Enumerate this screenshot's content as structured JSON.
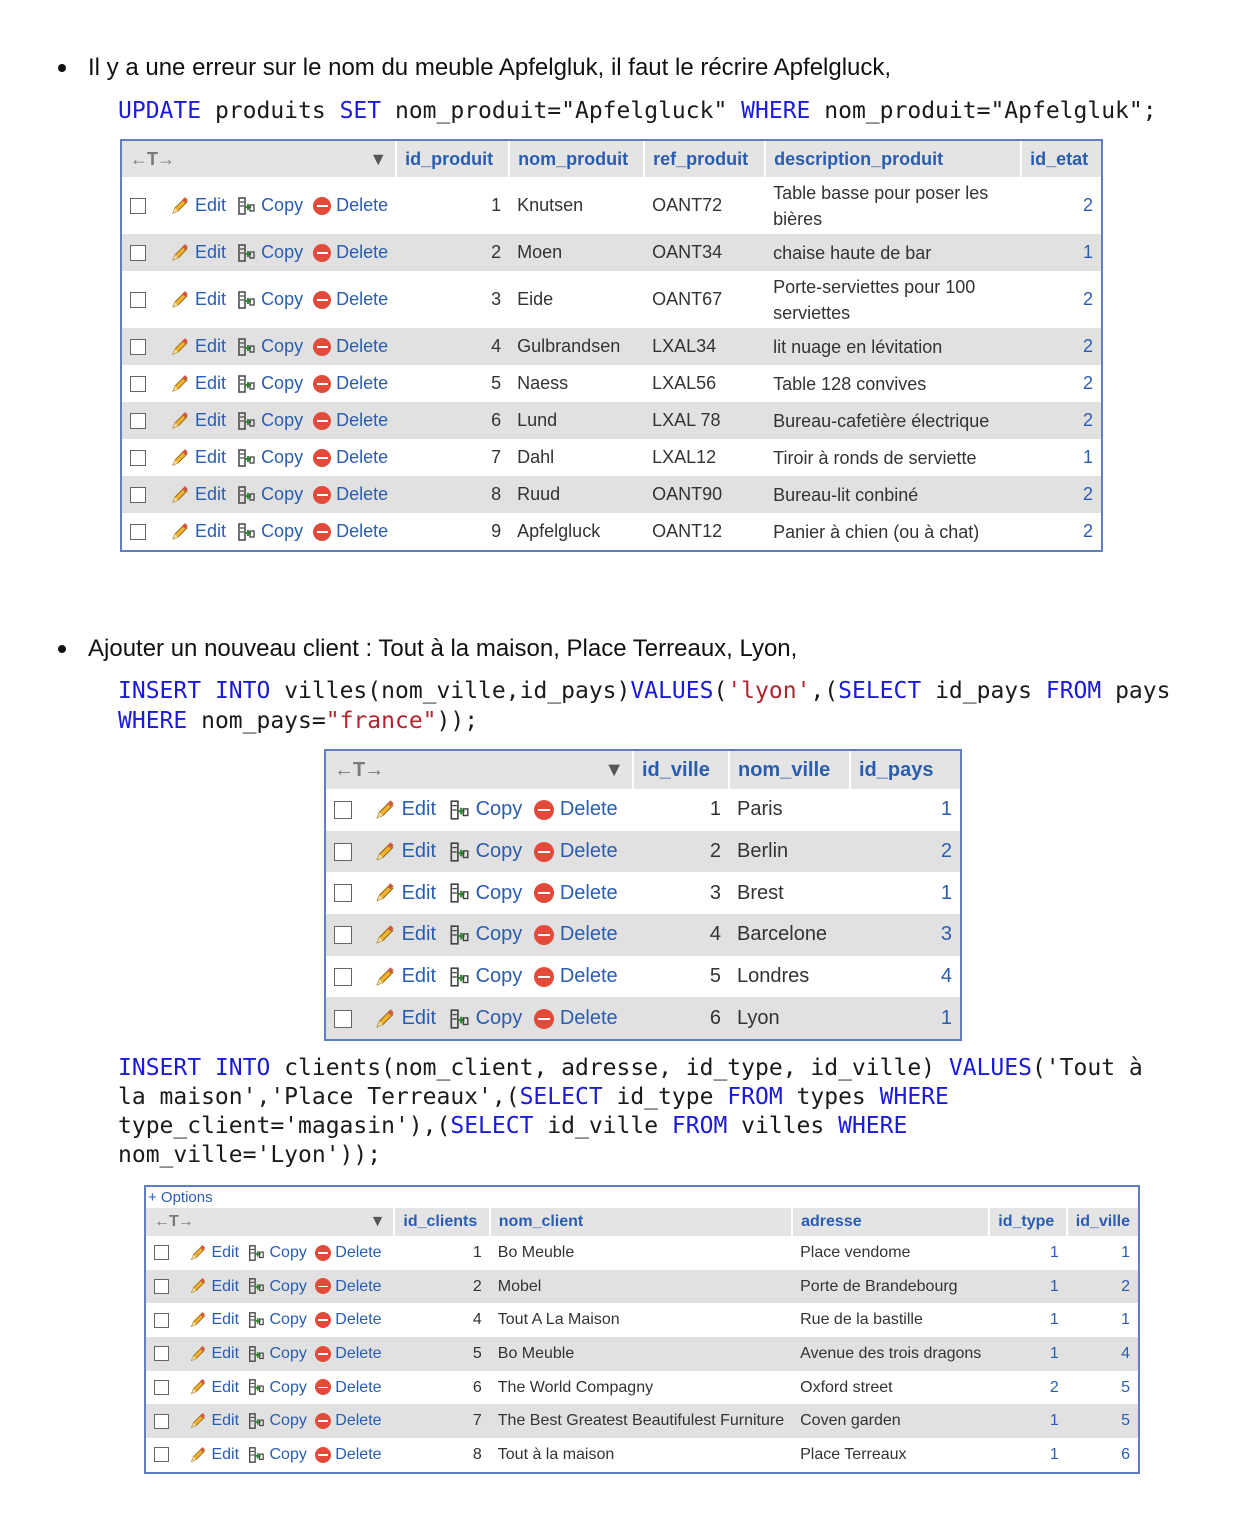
{
  "section1": {
    "bullet": "Il y a une erreur sur le nom du meuble Apfelgluk, il faut le récrire Apfelgluck,",
    "sql": {
      "kw1": "UPDATE",
      "t1": " produits ",
      "kw2": "SET",
      "t2": " nom_produit=",
      "s1": "\"Apfelgluck\"",
      "t3": " ",
      "kw3": "WHERE",
      "t4": " nom_produit=",
      "s2": "\"Apfelgluk\"",
      "t5": ";"
    },
    "table": {
      "headers": [
        "id_produit",
        "nom_produit",
        "ref_produit",
        "description_produit",
        "id_etat"
      ],
      "rows": [
        {
          "id": "1",
          "nom": "Knutsen",
          "ref": "OANT72",
          "desc": "Table basse pour poser les bières",
          "etat": "2"
        },
        {
          "id": "2",
          "nom": "Moen",
          "ref": "OANT34",
          "desc": "chaise haute de bar",
          "etat": "1"
        },
        {
          "id": "3",
          "nom": "Eide",
          "ref": "OANT67",
          "desc": "Porte-serviettes pour 100 serviettes",
          "etat": "2"
        },
        {
          "id": "4",
          "nom": "Gulbrandsen",
          "ref": "LXAL34",
          "desc": "lit nuage en lévitation",
          "etat": "2"
        },
        {
          "id": "5",
          "nom": "Naess",
          "ref": "LXAL56",
          "desc": "Table 128 convives",
          "etat": "2"
        },
        {
          "id": "6",
          "nom": "Lund",
          "ref": "LXAL 78",
          "desc": "Bureau-cafetière électrique",
          "etat": "2"
        },
        {
          "id": "7",
          "nom": "Dahl",
          "ref": "LXAL12",
          "desc": "Tiroir à ronds de serviette",
          "etat": "1"
        },
        {
          "id": "8",
          "nom": "Ruud",
          "ref": "OANT90",
          "desc": "Bureau-lit conbiné",
          "etat": "2"
        },
        {
          "id": "9",
          "nom": "Apfelgluck",
          "ref": "OANT12",
          "desc": "Panier à chien (ou à chat)",
          "etat": "2"
        }
      ]
    }
  },
  "section2": {
    "bullet": "Ajouter un nouveau client : Tout à la maison, Place Terreaux, Lyon,",
    "sql1": {
      "kw1": "INSERT",
      "t0": " ",
      "kw2": "INTO",
      "t1": " villes(nom_ville,id_pays)",
      "kw3": "VALUES",
      "t2": "(",
      "s1": "'lyon'",
      "t3": ",(",
      "kw4": "SELECT",
      "t4": " id_pays ",
      "kw5": "FROM",
      "t5": " pays",
      "kw6": "WHERE",
      "t6": " nom_pays=",
      "s2": "\"france\"",
      "t7": "));"
    },
    "villes": {
      "headers": [
        "id_ville",
        "nom_ville",
        "id_pays"
      ],
      "rows": [
        {
          "id": "1",
          "nom": "Paris",
          "pays": "1"
        },
        {
          "id": "2",
          "nom": "Berlin",
          "pays": "2"
        },
        {
          "id": "3",
          "nom": "Brest",
          "pays": "1"
        },
        {
          "id": "4",
          "nom": "Barcelone",
          "pays": "3"
        },
        {
          "id": "5",
          "nom": "Londres",
          "pays": "4"
        },
        {
          "id": "6",
          "nom": "Lyon",
          "pays": "1"
        }
      ]
    },
    "sql2": {
      "l1_kw1": "INSERT",
      "l1_t0": " ",
      "l1_kw2": "INTO",
      "l1_t1": " clients(nom_client, adresse, id_type, id_ville) ",
      "l1_kw3": "VALUES",
      "l1_t2": "('Tout à",
      "l2_t1": "la maison','Place Terreaux',(",
      "l2_kw1": "SELECT",
      "l2_t2": " id_type ",
      "l2_kw2": "FROM",
      "l2_t3": " types ",
      "l2_kw3": "WHERE",
      "l3_t1": "type_client='magasin'),(",
      "l3_kw1": "SELECT",
      "l3_t2": " id_ville ",
      "l3_kw2": "FROM",
      "l3_t3": " villes ",
      "l3_kw3": "WHERE",
      "l4_t1": "nom_ville='Lyon'));"
    },
    "clients": {
      "options": "+ Options",
      "headers": [
        "id_clients",
        "nom_client",
        "adresse",
        "id_type",
        "id_ville"
      ],
      "rows": [
        {
          "id": "1",
          "nom": "Bo Meuble",
          "adresse": "Place vendome",
          "type": "1",
          "ville": "1"
        },
        {
          "id": "2",
          "nom": "Mobel",
          "adresse": "Porte de Brandebourg",
          "type": "1",
          "ville": "2"
        },
        {
          "id": "4",
          "nom": "Tout A La Maison",
          "adresse": "Rue de la bastille",
          "type": "1",
          "ville": "1"
        },
        {
          "id": "5",
          "nom": "Bo Meuble",
          "adresse": "Avenue des trois dragons",
          "type": "1",
          "ville": "4"
        },
        {
          "id": "6",
          "nom": "The World Compagny",
          "adresse": "Oxford street",
          "type": "2",
          "ville": "5"
        },
        {
          "id": "7",
          "nom": "The Best Greatest Beautifulest Furniture",
          "adresse": "Coven garden",
          "type": "1",
          "ville": "5"
        },
        {
          "id": "8",
          "nom": "Tout à la maison",
          "adresse": "Place Terreaux",
          "type": "1",
          "ville": "6"
        }
      ]
    }
  },
  "actions": {
    "edit": "Edit",
    "copy": "Copy",
    "delete": "Delete"
  },
  "icons": {
    "nav": "←T→",
    "sort": "▼"
  }
}
